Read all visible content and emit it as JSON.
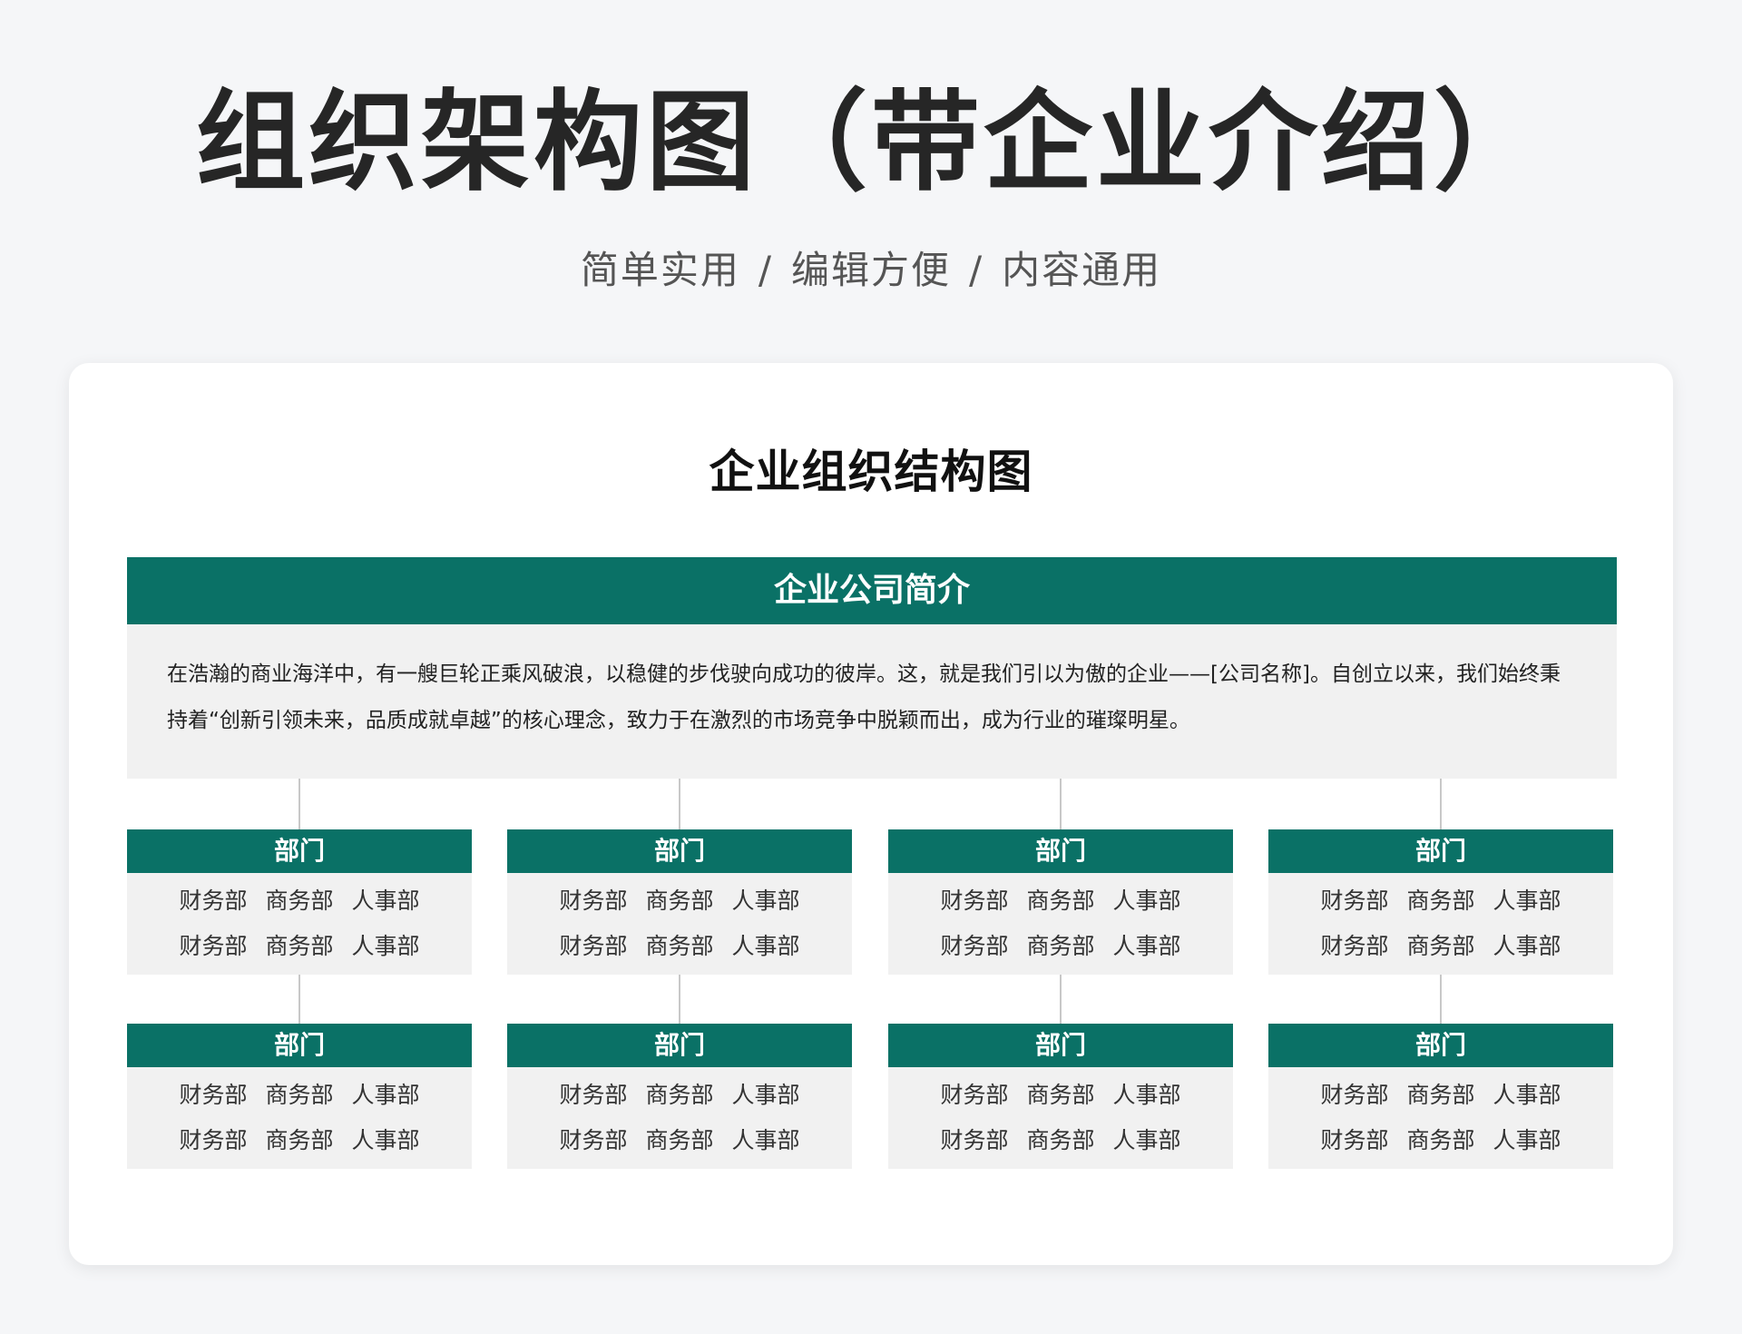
{
  "header": {
    "title": "组织架构图（带企业介绍）",
    "subtitle_parts": [
      "简单实用",
      "编辑方便",
      "内容通用"
    ],
    "separator": "/"
  },
  "card": {
    "title": "企业组织结构图",
    "intro_heading": "企业公司简介",
    "intro_text": "在浩瀚的商业海洋中，有一艘巨轮正乘风破浪，以稳健的步伐驶向成功的彼岸。这，就是我们引以为傲的企业——[公司名称]。自创立以来，我们始终秉持着“创新引领未来，品质成就卓越”的核心理念，致力于在激烈的市场竞争中脱颖而出，成为行业的璀璨明星。"
  },
  "departments": [
    {
      "name": "部门",
      "rows": [
        [
          "财务部",
          "商务部",
          "人事部"
        ],
        [
          "财务部",
          "商务部",
          "人事部"
        ]
      ]
    },
    {
      "name": "部门",
      "rows": [
        [
          "财务部",
          "商务部",
          "人事部"
        ],
        [
          "财务部",
          "商务部",
          "人事部"
        ]
      ]
    },
    {
      "name": "部门",
      "rows": [
        [
          "财务部",
          "商务部",
          "人事部"
        ],
        [
          "财务部",
          "商务部",
          "人事部"
        ]
      ]
    },
    {
      "name": "部门",
      "rows": [
        [
          "财务部",
          "商务部",
          "人事部"
        ],
        [
          "财务部",
          "商务部",
          "人事部"
        ]
      ]
    },
    {
      "name": "部门",
      "rows": [
        [
          "财务部",
          "商务部",
          "人事部"
        ],
        [
          "财务部",
          "商务部",
          "人事部"
        ]
      ]
    },
    {
      "name": "部门",
      "rows": [
        [
          "财务部",
          "商务部",
          "人事部"
        ],
        [
          "财务部",
          "商务部",
          "人事部"
        ]
      ]
    },
    {
      "name": "部门",
      "rows": [
        [
          "财务部",
          "商务部",
          "人事部"
        ],
        [
          "财务部",
          "商务部",
          "人事部"
        ]
      ]
    },
    {
      "name": "部门",
      "rows": [
        [
          "财务部",
          "商务部",
          "人事部"
        ],
        [
          "财务部",
          "商务部",
          "人事部"
        ]
      ]
    }
  ],
  "colors": {
    "accent": "#0a7166",
    "panel": "#f1f1f1",
    "background": "#f5f6f8"
  }
}
